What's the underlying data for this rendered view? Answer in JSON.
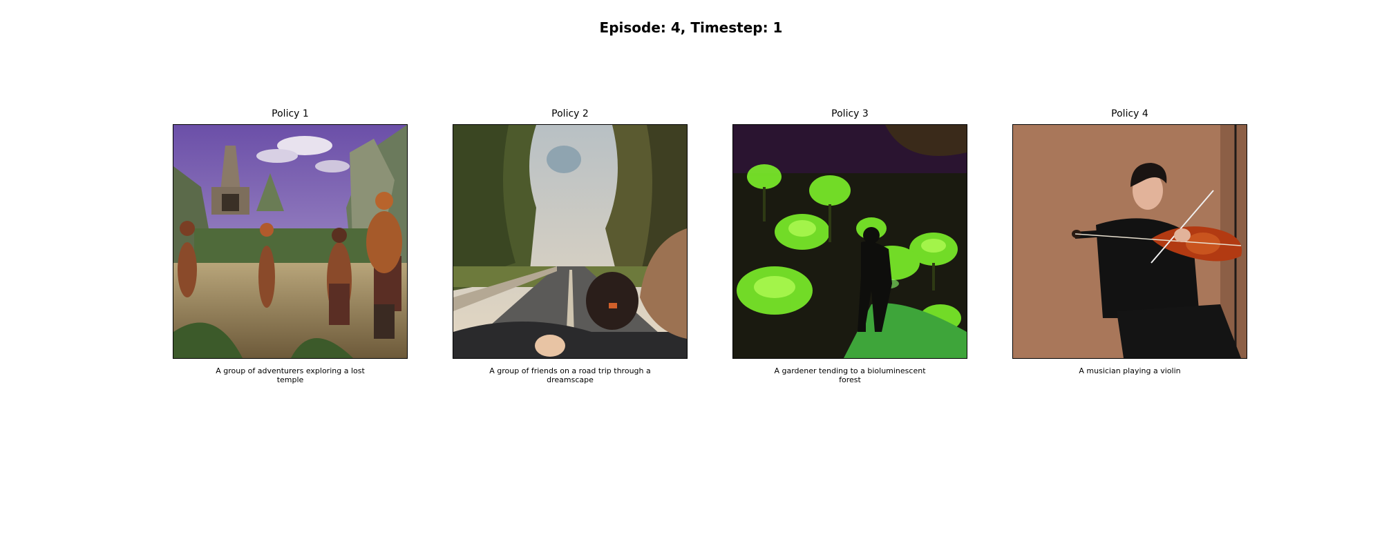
{
  "figure": {
    "title": "Episode: 4, Timestep: 1"
  },
  "panels": [
    {
      "title": "Policy 1",
      "caption": "A group of adventurers exploring a lost temple",
      "image": "adventurers-temple-image"
    },
    {
      "title": "Policy 2",
      "caption": "A group of friends on a road trip through a dreamscape",
      "image": "road-trip-image"
    },
    {
      "title": "Policy 3",
      "caption": "A gardener tending to a bioluminescent forest",
      "image": "glowing-forest-image"
    },
    {
      "title": "Policy 4",
      "caption": "A musician playing a violin",
      "image": "violinist-image"
    }
  ]
}
